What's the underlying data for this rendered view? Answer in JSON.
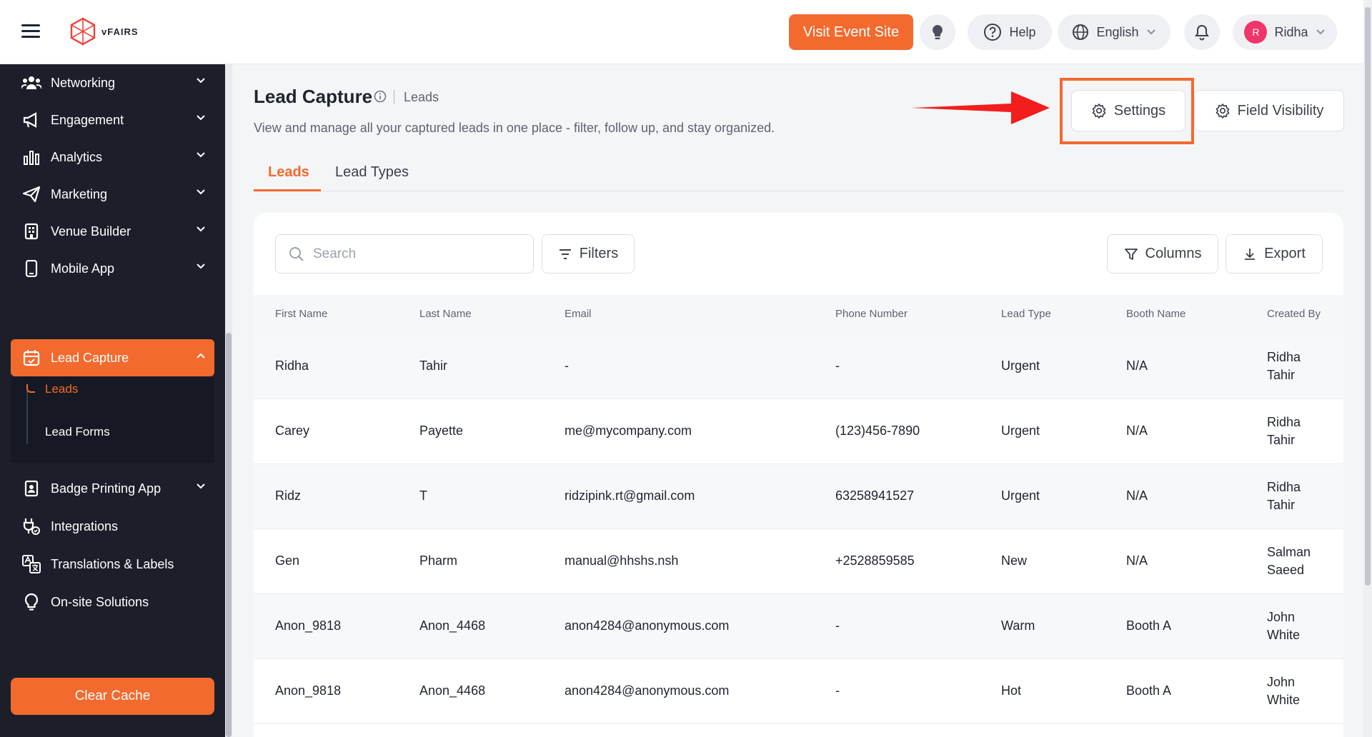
{
  "header": {
    "logo_text": "vFAIRS",
    "visit_button": "Visit Event Site",
    "help_label": "Help",
    "language": "English",
    "user_initial": "R",
    "user_name": "Ridha"
  },
  "sidebar": {
    "items": [
      {
        "label": "Networking",
        "icon": "networking-icon"
      },
      {
        "label": "Engagement",
        "icon": "megaphone-icon"
      },
      {
        "label": "Analytics",
        "icon": "bar-chart-icon"
      },
      {
        "label": "Marketing",
        "icon": "paper-plane-icon"
      },
      {
        "label": "Venue Builder",
        "icon": "building-icon"
      },
      {
        "label": "Mobile App",
        "icon": "phone-icon"
      },
      {
        "label": "Lead Capture",
        "icon": "calendar-check-icon"
      },
      {
        "label": "Badge Printing App",
        "icon": "badge-icon"
      },
      {
        "label": "Integrations",
        "icon": "plug-icon"
      },
      {
        "label": "Translations & Labels",
        "icon": "translate-icon"
      },
      {
        "label": "On-site Solutions",
        "icon": "lightbulb-icon"
      }
    ],
    "sub_items": [
      {
        "label": "Leads"
      },
      {
        "label": "Lead Forms"
      }
    ],
    "clear_cache": "Clear Cache"
  },
  "page": {
    "title": "Lead Capture",
    "breadcrumb": "Leads",
    "subtitle": "View and manage all your captured leads in one place - filter, follow up, and stay organized.",
    "settings_button": "Settings",
    "field_visibility_button": "Field Visibility",
    "tabs": [
      {
        "label": "Leads"
      },
      {
        "label": "Lead Types"
      }
    ]
  },
  "toolbar": {
    "search_placeholder": "Search",
    "filters": "Filters",
    "columns": "Columns",
    "export": "Export"
  },
  "table": {
    "columns": [
      "First Name",
      "Last Name",
      "Email",
      "Phone Number",
      "Lead Type",
      "Booth Name",
      "Created By"
    ],
    "rows": [
      {
        "first": "Ridha",
        "last": "Tahir",
        "email": "-",
        "phone": "-",
        "type": "Urgent",
        "booth": "N/A",
        "creator1": "Ridha",
        "creator2": "Tahir"
      },
      {
        "first": "Carey",
        "last": "Payette",
        "email": "me@mycompany.com",
        "phone": "(123)456-7890",
        "type": "Urgent",
        "booth": "N/A",
        "creator1": "Ridha",
        "creator2": "Tahir"
      },
      {
        "first": "Ridz",
        "last": "T",
        "email": "ridzipink.rt@gmail.com",
        "phone": "63258941527",
        "type": "Urgent",
        "booth": "N/A",
        "creator1": "Ridha",
        "creator2": "Tahir"
      },
      {
        "first": "Gen",
        "last": "Pharm",
        "email": "manual@hhshs.nsh",
        "phone": "+2528859585",
        "type": "New",
        "booth": "N/A",
        "creator1": "Salman",
        "creator2": "Saeed"
      },
      {
        "first": "Anon_9818",
        "last": "Anon_4468",
        "email": "anon4284@anonymous.com",
        "phone": "-",
        "type": "Warm",
        "booth": "Booth A",
        "creator1": "John",
        "creator2": "White"
      },
      {
        "first": "Anon_9818",
        "last": "Anon_4468",
        "email": "anon4284@anonymous.com",
        "phone": "-",
        "type": "Hot",
        "booth": "Booth A",
        "creator1": "John",
        "creator2": "White"
      }
    ]
  },
  "colors": {
    "accent": "#f26a2e",
    "sidebar_bg": "#1c1f2a",
    "annotation_arrow": "#f21d1d"
  }
}
